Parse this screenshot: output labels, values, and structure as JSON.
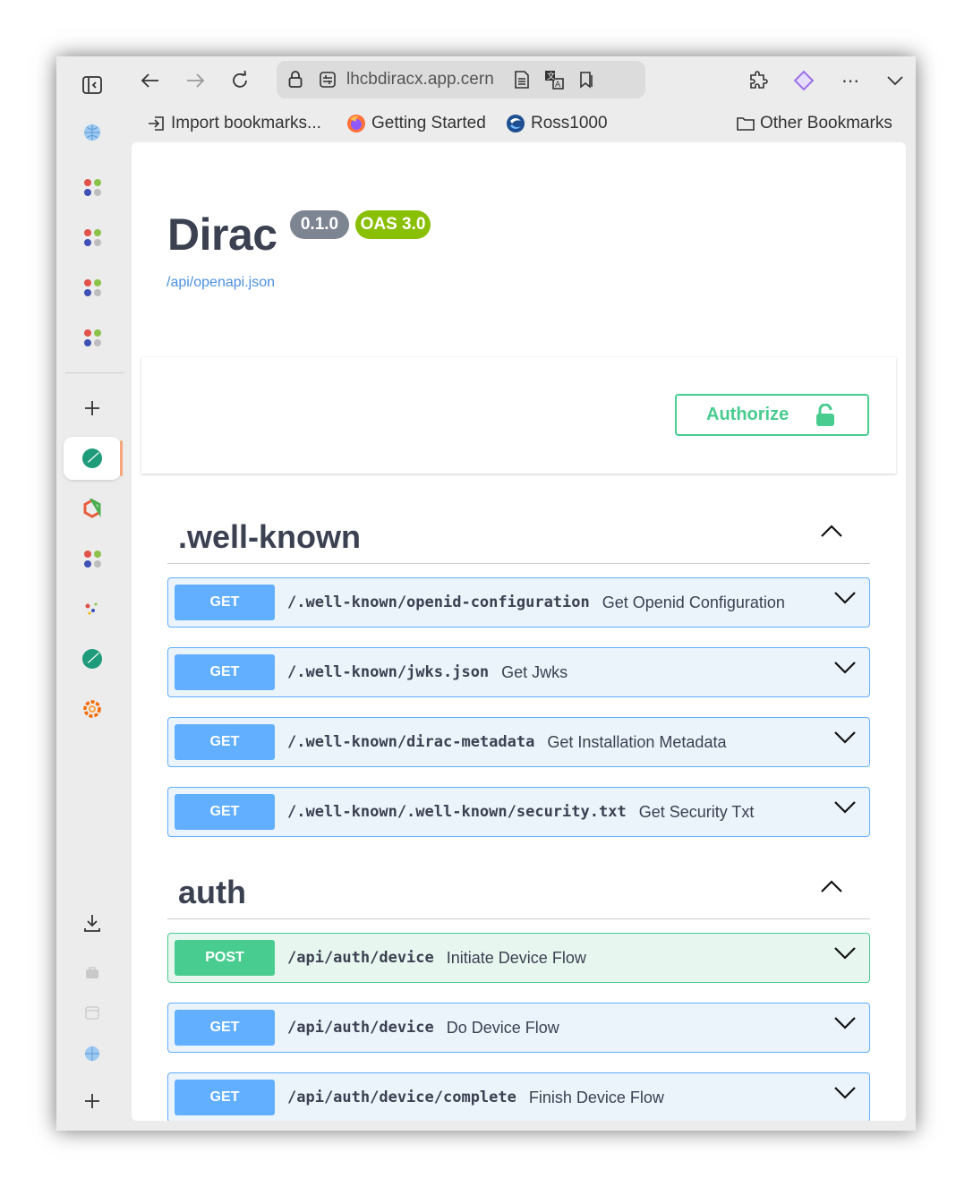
{
  "browser": {
    "url": "lhcbdiracx.app.cern",
    "bookmarks": [
      {
        "label": "Import bookmarks..."
      },
      {
        "label": "Getting Started"
      },
      {
        "label": "Ross1000"
      }
    ],
    "other_bookmarks": "Other Bookmarks",
    "more_label": "⋯"
  },
  "api": {
    "title": "Dirac",
    "version": "0.1.0",
    "oas": "OAS 3.0",
    "spec_link": "/api/openapi.json",
    "authorize_label": "Authorize"
  },
  "tags": [
    {
      "name": ".well-known",
      "operations": [
        {
          "method": "GET",
          "path": "/.well-known/openid-configuration",
          "summary": "Get Openid Configuration"
        },
        {
          "method": "GET",
          "path": "/.well-known/jwks.json",
          "summary": "Get Jwks"
        },
        {
          "method": "GET",
          "path": "/.well-known/dirac-metadata",
          "summary": "Get Installation Metadata"
        },
        {
          "method": "GET",
          "path": "/.well-known/.well-known/security.txt",
          "summary": "Get Security Txt"
        }
      ]
    },
    {
      "name": "auth",
      "operations": [
        {
          "method": "POST",
          "path": "/api/auth/device",
          "summary": "Initiate Device Flow"
        },
        {
          "method": "GET",
          "path": "/api/auth/device",
          "summary": "Do Device Flow"
        },
        {
          "method": "GET",
          "path": "/api/auth/device/complete",
          "summary": "Finish Device Flow"
        }
      ]
    }
  ],
  "colors": {
    "get": "#61affe",
    "post": "#49cc90",
    "version_badge": "#7d8492",
    "oas_badge": "#89bf04",
    "link": "#4990e2"
  }
}
